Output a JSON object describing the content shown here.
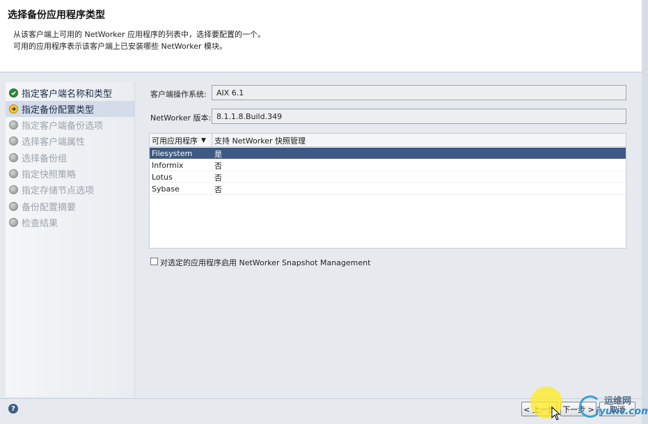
{
  "header": {
    "title": "选择备份应用程序类型",
    "description_line1": "从该客户端上可用的 NetWorker 应用程序的列表中，选择要配置的一个。",
    "description_line2": "可用的应用程序表示该客户端上已安装哪些 NetWorker 模块。"
  },
  "steps": [
    {
      "label": "指定客户端名称和类型",
      "status": "completed",
      "icon": "check-icon"
    },
    {
      "label": "指定备份配置类型",
      "status": "current",
      "icon": "arrow-right-icon"
    },
    {
      "label": "指定客户端备份选项",
      "status": "pending",
      "icon": "circle-icon"
    },
    {
      "label": "选择客户端属性",
      "status": "pending",
      "icon": "circle-icon"
    },
    {
      "label": "选择备份组",
      "status": "pending",
      "icon": "circle-icon"
    },
    {
      "label": "指定快照策略",
      "status": "pending",
      "icon": "circle-icon"
    },
    {
      "label": "指定存储节点选项",
      "status": "pending",
      "icon": "circle-icon"
    },
    {
      "label": "备份配置摘要",
      "status": "pending",
      "icon": "circle-icon"
    },
    {
      "label": "检查结果",
      "status": "pending",
      "icon": "circle-icon"
    }
  ],
  "form": {
    "os_label": "客户端操作系统:",
    "os_value": "AIX 6.1",
    "version_label": "NetWorker 版本:",
    "version_value": "8.1.1.8.Build.349"
  },
  "table": {
    "columns": [
      "可用应用程序",
      "支持 NetWorker 快照管理"
    ],
    "sort_icon": "sort-down-icon",
    "rows": [
      {
        "app": "Filesystem",
        "snapshot": "是",
        "selected": true
      },
      {
        "app": "Informix",
        "snapshot": "否",
        "selected": false
      },
      {
        "app": "Lotus",
        "snapshot": "否",
        "selected": false
      },
      {
        "app": "Sybase",
        "snapshot": "否",
        "selected": false
      }
    ]
  },
  "snapshot_checkbox": {
    "label": "对选定的应用程序启用 NetWorker Snapshot Management",
    "checked": false
  },
  "footer": {
    "help_icon": "question-icon",
    "back_label": "< 上一步",
    "next_label": "下一步 >",
    "cancel_label": "取消"
  },
  "watermark": {
    "cn": "运维网",
    "en": "iyunv.com"
  },
  "colors": {
    "accent": "#3f5a82",
    "completed": "#2e8b3a",
    "current": "#f3c72b",
    "pending": "#9ba3ab"
  }
}
